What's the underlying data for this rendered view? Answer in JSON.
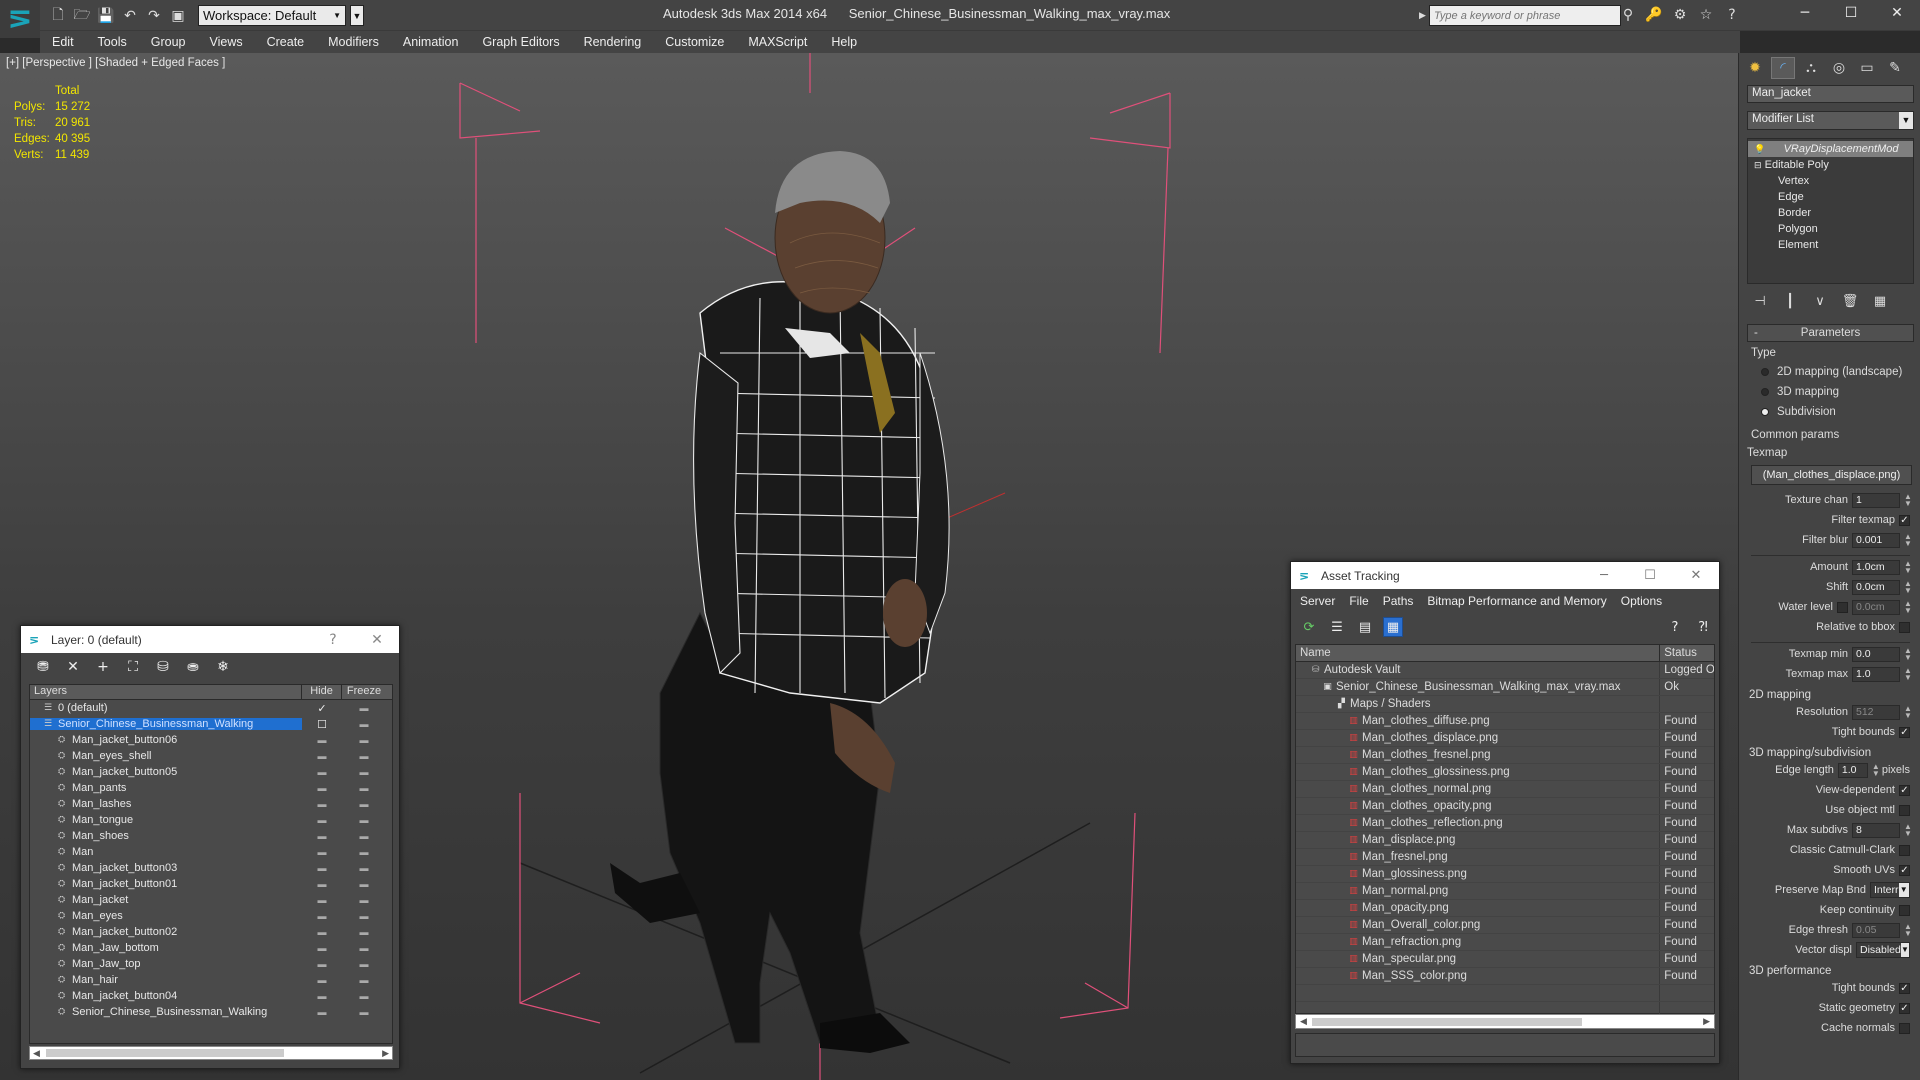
{
  "app": {
    "title": "Autodesk 3ds Max 2014 x64      Senior_Chinese_Businessman_Walking_max_vray.max",
    "workspace": "Workspace: Default",
    "search_placeholder": "Type a keyword or phrase",
    "accent": "#1aa3b8"
  },
  "menu": [
    "Edit",
    "Tools",
    "Group",
    "Views",
    "Create",
    "Modifiers",
    "Animation",
    "Graph Editors",
    "Rendering",
    "Customize",
    "MAXScript",
    "Help"
  ],
  "viewport": {
    "label": "[+] [Perspective ] [Shaded + Edged Faces ]",
    "stats": {
      "header": "Total",
      "rows": [
        {
          "k": "Polys:",
          "v": "15 272"
        },
        {
          "k": "Tris:",
          "v": "20 961"
        },
        {
          "k": "Edges:",
          "v": "40 395"
        },
        {
          "k": "Verts:",
          "v": "11 439"
        }
      ]
    }
  },
  "command_panel": {
    "object_name": "Man_jacket",
    "modifier_list": "Modifier List",
    "stack": [
      "VRayDisplacementMod",
      "Editable Poly",
      "Vertex",
      "Edge",
      "Border",
      "Polygon",
      "Element"
    ],
    "parameters": "Parameters",
    "type_label": "Type",
    "type_options": [
      "2D mapping (landscape)",
      "3D mapping",
      "Subdivision"
    ],
    "selected_type": "Subdivision",
    "common_params": "Common params",
    "texmap_label": "Texmap",
    "texmap_value": "(Man_clothes_displace.png)",
    "texture_chan": {
      "label": "Texture chan",
      "value": "1"
    },
    "filter_texmap": "Filter texmap",
    "filter_blur": {
      "label": "Filter blur",
      "value": "0.001"
    },
    "amount": {
      "label": "Amount",
      "value": "1.0cm"
    },
    "shift": {
      "label": "Shift",
      "value": "0.0cm"
    },
    "water_level": {
      "label": "Water level",
      "value": "0.0cm"
    },
    "relative_bbox": "Relative to bbox",
    "texmap_min": {
      "label": "Texmap min",
      "value": "0.0"
    },
    "texmap_max": {
      "label": "Texmap max",
      "value": "1.0"
    },
    "mapping_2d": "2D mapping",
    "resolution": {
      "label": "Resolution",
      "value": "512"
    },
    "tight_bounds_2d": "Tight bounds",
    "mapping_3d": "3D mapping/subdivision",
    "edge_length": {
      "label": "Edge length",
      "value": "1.0",
      "unit": "pixels"
    },
    "view_dependent": "View-dependent",
    "use_object_mtl": "Use object mtl",
    "max_subdivs": {
      "label": "Max subdivs",
      "value": "8"
    },
    "classic_catmull": "Classic Catmull-Clark",
    "smooth_uvs": "Smooth UVs",
    "preserve_map": {
      "label": "Preserve Map Bnd",
      "value": "Interr"
    },
    "keep_continuity": "Keep continuity",
    "edge_thresh": {
      "label": "Edge thresh",
      "value": "0.05"
    },
    "vector_displ": {
      "label": "Vector displ",
      "value": "Disabled"
    },
    "perf_3d": "3D performance",
    "tight_bounds_3d": "Tight bounds",
    "static_geometry": "Static geometry",
    "cache_normals": "Cache normals"
  },
  "layer_window": {
    "title": "Layer: 0 (default)",
    "help": "?",
    "col_layers": "Layers",
    "col_hide": "Hide",
    "col_freeze": "Freeze",
    "rows": [
      {
        "name": "0 (default)",
        "level": 0
      },
      {
        "name": "Senior_Chinese_Businessman_Walking",
        "level": 0,
        "selected": true
      },
      {
        "name": "Man_jacket_button06",
        "level": 1
      },
      {
        "name": "Man_eyes_shell",
        "level": 1
      },
      {
        "name": "Man_jacket_button05",
        "level": 1
      },
      {
        "name": "Man_pants",
        "level": 1
      },
      {
        "name": "Man_lashes",
        "level": 1
      },
      {
        "name": "Man_tongue",
        "level": 1
      },
      {
        "name": "Man_shoes",
        "level": 1
      },
      {
        "name": "Man",
        "level": 1
      },
      {
        "name": "Man_jacket_button03",
        "level": 1
      },
      {
        "name": "Man_jacket_button01",
        "level": 1
      },
      {
        "name": "Man_jacket",
        "level": 1
      },
      {
        "name": "Man_eyes",
        "level": 1
      },
      {
        "name": "Man_jacket_button02",
        "level": 1
      },
      {
        "name": "Man_Jaw_bottom",
        "level": 1
      },
      {
        "name": "Man_Jaw_top",
        "level": 1
      },
      {
        "name": "Man_hair",
        "level": 1
      },
      {
        "name": "Man_jacket_button04",
        "level": 1
      },
      {
        "name": "Senior_Chinese_Businessman_Walking",
        "level": 1
      }
    ]
  },
  "asset_window": {
    "title": "Asset Tracking",
    "menu": [
      "Server",
      "File",
      "Paths",
      "Bitmap Performance and Memory",
      "Options"
    ],
    "col_name": "Name",
    "col_status": "Status",
    "rows": [
      {
        "name": "Autodesk Vault",
        "status": "Logged O",
        "kind": "vault",
        "level": 0
      },
      {
        "name": "Senior_Chinese_Businessman_Walking_max_vray.max",
        "status": "Ok",
        "kind": "max",
        "level": 1
      },
      {
        "name": "Maps / Shaders",
        "status": "",
        "kind": "folder",
        "level": 2
      },
      {
        "name": "Man_clothes_diffuse.png",
        "status": "Found",
        "kind": "png",
        "level": 3
      },
      {
        "name": "Man_clothes_displace.png",
        "status": "Found",
        "kind": "png",
        "level": 3
      },
      {
        "name": "Man_clothes_fresnel.png",
        "status": "Found",
        "kind": "png",
        "level": 3
      },
      {
        "name": "Man_clothes_glossiness.png",
        "status": "Found",
        "kind": "png",
        "level": 3
      },
      {
        "name": "Man_clothes_normal.png",
        "status": "Found",
        "kind": "png",
        "level": 3
      },
      {
        "name": "Man_clothes_opacity.png",
        "status": "Found",
        "kind": "png",
        "level": 3
      },
      {
        "name": "Man_clothes_reflection.png",
        "status": "Found",
        "kind": "png",
        "level": 3
      },
      {
        "name": "Man_displace.png",
        "status": "Found",
        "kind": "png",
        "level": 3
      },
      {
        "name": "Man_fresnel.png",
        "status": "Found",
        "kind": "png",
        "level": 3
      },
      {
        "name": "Man_glossiness.png",
        "status": "Found",
        "kind": "png",
        "level": 3
      },
      {
        "name": "Man_normal.png",
        "status": "Found",
        "kind": "png",
        "level": 3
      },
      {
        "name": "Man_opacity.png",
        "status": "Found",
        "kind": "png",
        "level": 3
      },
      {
        "name": "Man_Overall_color.png",
        "status": "Found",
        "kind": "png",
        "level": 3
      },
      {
        "name": "Man_refraction.png",
        "status": "Found",
        "kind": "png",
        "level": 3
      },
      {
        "name": "Man_specular.png",
        "status": "Found",
        "kind": "png",
        "level": 3
      },
      {
        "name": "Man_SSS_color.png",
        "status": "Found",
        "kind": "png",
        "level": 3
      }
    ]
  }
}
